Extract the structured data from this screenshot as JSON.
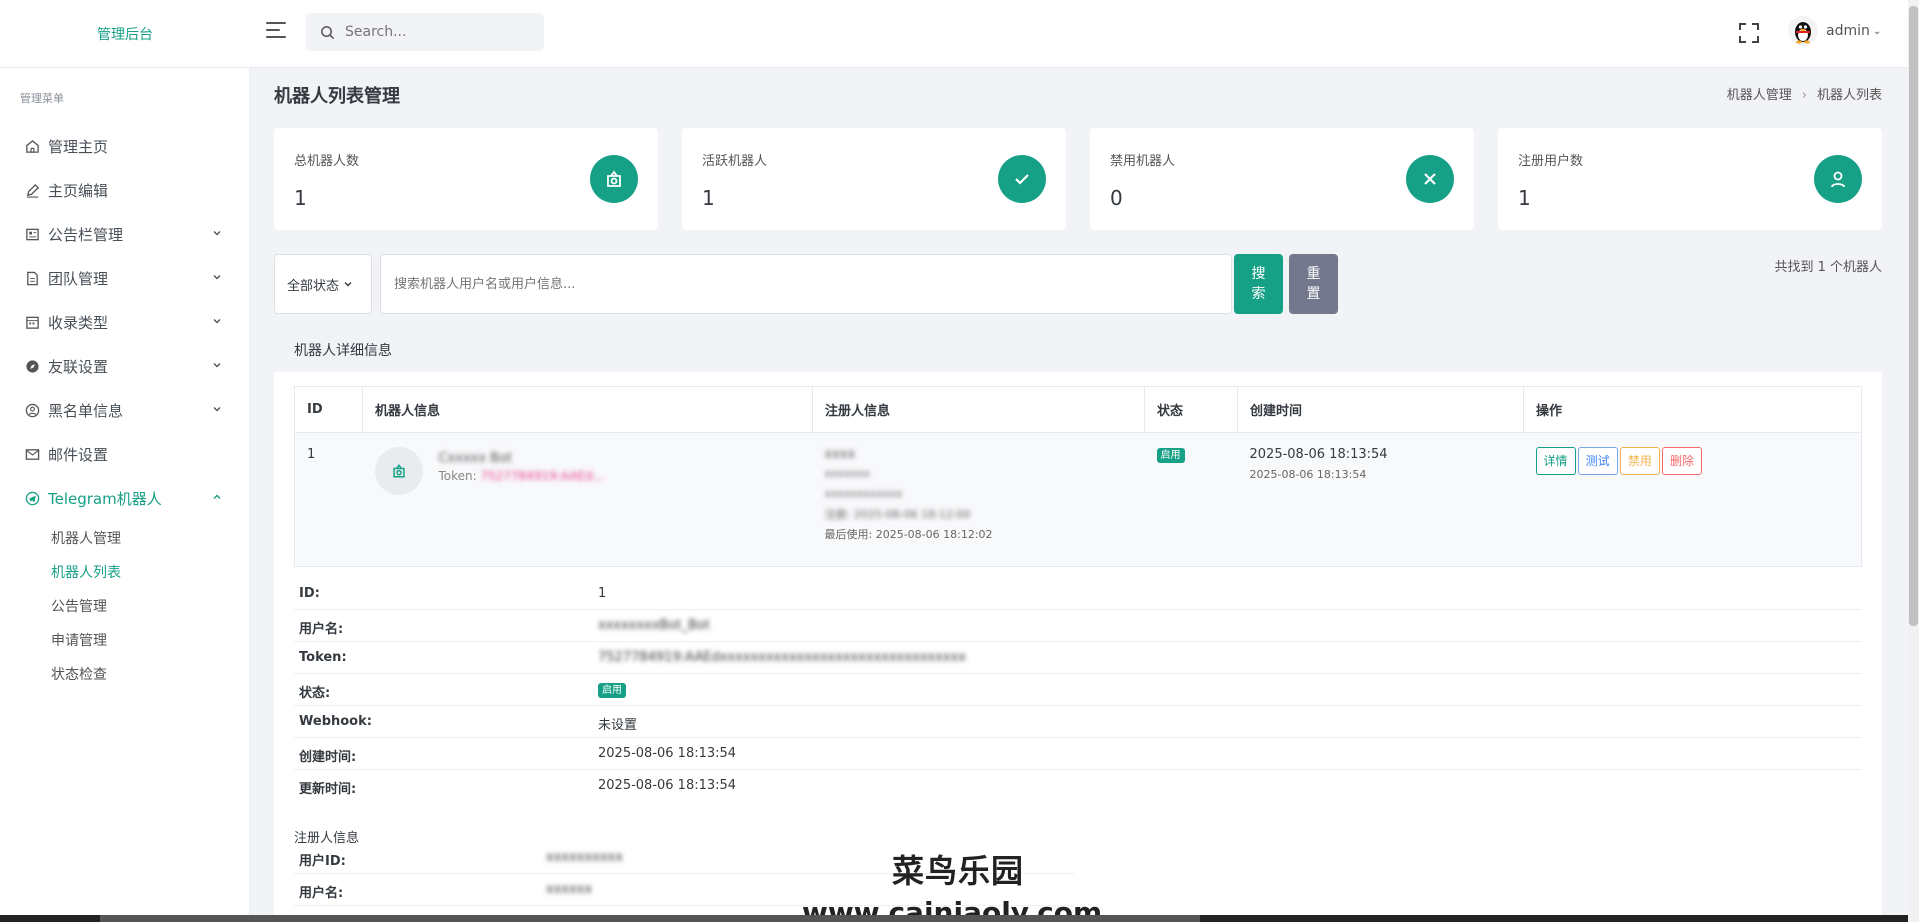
{
  "brand": "管理后台",
  "search": {
    "placeholder": "Search..."
  },
  "user": {
    "name": "admin"
  },
  "sidebar": {
    "title": "管理菜单",
    "items": [
      {
        "label": "管理主页",
        "icon": "home-icon"
      },
      {
        "label": "主页编辑",
        "icon": "edit-icon"
      },
      {
        "label": "公告栏管理",
        "icon": "newspaper-icon"
      },
      {
        "label": "团队管理",
        "icon": "file-icon"
      },
      {
        "label": "收录类型",
        "icon": "calendar-icon"
      },
      {
        "label": "友联设置",
        "icon": "compass-icon"
      },
      {
        "label": "黑名单信息",
        "icon": "user-circle-icon"
      },
      {
        "label": "邮件设置",
        "icon": "mail-icon"
      },
      {
        "label": "Telegram机器人",
        "icon": "telegram-icon"
      }
    ],
    "sub_items": [
      "机器人管理",
      "机器人列表",
      "公告管理",
      "申请管理",
      "状态检查"
    ]
  },
  "page": {
    "title": "机器人列表管理",
    "breadcrumb": [
      "机器人管理",
      "机器人列表"
    ]
  },
  "stats": [
    {
      "label": "总机器人数",
      "value": "1",
      "icon": "robot-icon"
    },
    {
      "label": "活跃机器人",
      "value": "1",
      "icon": "check-icon"
    },
    {
      "label": "禁用机器人",
      "value": "0",
      "icon": "x-icon"
    },
    {
      "label": "注册用户数",
      "value": "1",
      "icon": "user-icon"
    }
  ],
  "filter": {
    "status_select": "全部状态",
    "placeholder": "搜索机器人用户名或用户信息...",
    "search_label": "搜\n索",
    "reset_label": "重\n置",
    "result_count": "共找到 1 个机器人"
  },
  "detail": {
    "header": "机器人详细信息",
    "columns": [
      "ID",
      "机器人信息",
      "注册人信息",
      "状态",
      "创建时间",
      "操作"
    ],
    "row": {
      "id": "1",
      "robot_name": "Cxxxxx Bot",
      "token_label": "Token: ",
      "token_value": "7527784919:AAEd...",
      "reg_line1": "xxxx",
      "reg_line2": "xxxxxxx",
      "reg_line3": "xxxxxxxxxxxx",
      "reg_line4": "注册: 2025-08-06 18:12:00",
      "last_used": "最后使用: 2025-08-06 18:12:02",
      "status": "启用",
      "created_main": "2025-08-06 18:13:54",
      "created_sub": "2025-08-06 18:13:54",
      "actions": [
        "详情",
        "测试",
        "禁用",
        "删除"
      ]
    },
    "fields": [
      {
        "key": "ID:",
        "value": "1"
      },
      {
        "key": "用户名:",
        "value": "xxxxxxxxBot_Bot"
      },
      {
        "key": "Token:",
        "value": "7527784919:AAEdxxxxxxxxxxxxxxxxxxxxxxxxxxxxxxxx"
      },
      {
        "key": "状态:",
        "value": "启用"
      },
      {
        "key": "Webhook:",
        "value": "未设置"
      },
      {
        "key": "创建时间:",
        "value": "2025-08-06 18:13:54"
      },
      {
        "key": "更新时间:",
        "value": "2025-08-06 18:13:54"
      }
    ],
    "registrant_title": "注册人信息",
    "registrant_fields": [
      {
        "key": "用户ID:",
        "value": "xxxxxxxxxx"
      },
      {
        "key": "用户名:",
        "value": "xxxxxx"
      }
    ]
  },
  "watermark": {
    "line1": "菜鸟乐园",
    "line2": "www.cainiaoly.com"
  },
  "colors": {
    "accent": "#16a085",
    "reset": "#74788d",
    "danger": "#f46a6a",
    "warning": "#f1b44c",
    "info": "#3b82f6",
    "token": "#e83e8c"
  }
}
